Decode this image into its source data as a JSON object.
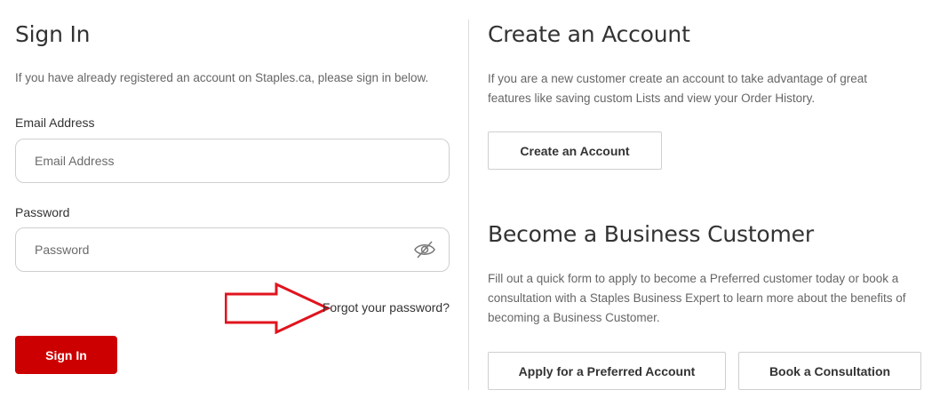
{
  "signin": {
    "title": "Sign In",
    "intro": "If you have already registered an account on Staples.ca, please sign in below.",
    "email_label": "Email Address",
    "email_placeholder": "Email Address",
    "password_label": "Password",
    "password_placeholder": "Password",
    "forgot_link": "Forgot your password?",
    "button_label": "Sign In"
  },
  "create_account": {
    "title": "Create an Account",
    "description": "If you are a new customer create an account to take advantage of great features like saving custom Lists and view your Order History.",
    "button_label": "Create an Account"
  },
  "business": {
    "title": "Become a Business Customer",
    "description": "Fill out a quick form to apply to become a Preferred customer today or book a consultation with a Staples Business Expert to learn more about the benefits of becoming a Business Customer.",
    "preferred_button_label": "Apply for a Preferred Account",
    "consultation_button_label": "Book a Consultation"
  },
  "colors": {
    "primary_red": "#cc0000",
    "annotation_arrow": "#e0141e",
    "text": "#333333",
    "muted_text": "#666666",
    "border": "#cfcfcf"
  },
  "icons": {
    "password_toggle": "eye-slash-icon",
    "annotation": "right-arrow-annotation"
  }
}
